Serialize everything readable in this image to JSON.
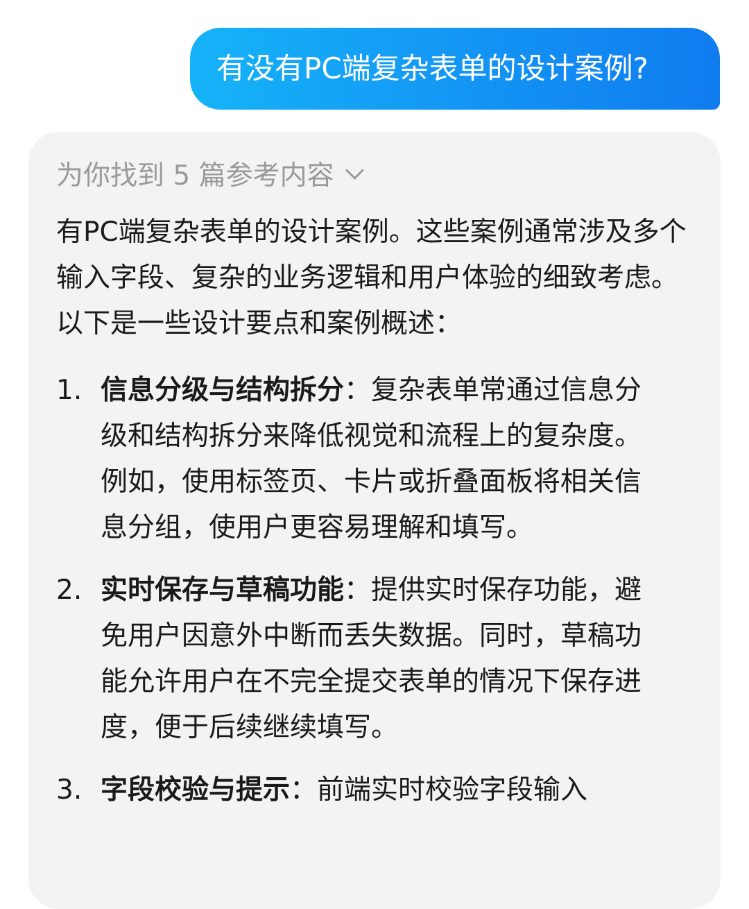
{
  "user_message": "有没有PC端复杂表单的设计案例?",
  "answer": {
    "references_label": "为你找到 5 篇参考内容",
    "intro": "有PC端复杂表单的设计案例。这些案例通常涉及多个输入字段、复杂的业务逻辑和用户体验的细致考虑。以下是一些设计要点和案例概述：",
    "items": [
      {
        "number": "1.",
        "title": "信息分级与结构拆分",
        "separator": "：",
        "text": "复杂表单常通过信息分级和结构拆分来降低视觉和流程上的复杂度。例如，使用标签页、卡片或折叠面板将相关信息分组，使用户更容易理解和填写。"
      },
      {
        "number": "2.",
        "title": "实时保存与草稿功能",
        "separator": "：",
        "text": "提供实时保存功能，避免用户因意外中断而丢失数据。同时，草稿功能允许用户在不完全提交表单的情况下保存进度，便于后续继续填写。"
      },
      {
        "number": "3.",
        "title": "字段校验与提示",
        "separator": "：",
        "text": "前端实时校验字段输入"
      }
    ]
  }
}
